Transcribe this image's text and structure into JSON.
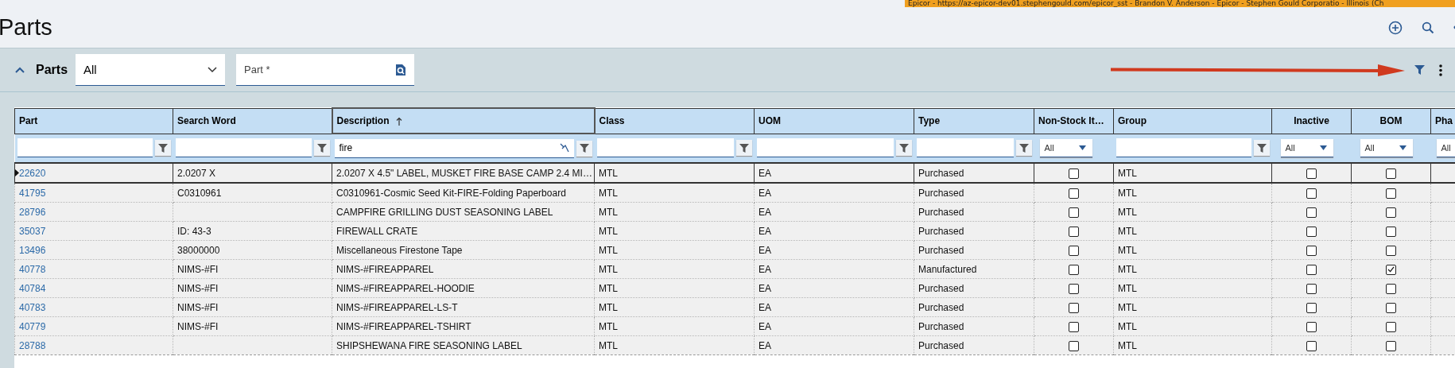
{
  "banner": {
    "text": "Epicor - https://az-epicor-dev01.stephengould.com/epicor_sst - Brandon V. Anderson - Epicor - Stephen Gould Corporatio - Illinois (Ch"
  },
  "page_title": "Parts",
  "toolbar": {
    "title": "Parts",
    "expanded": true,
    "view_select": {
      "value": "All"
    },
    "part_field": {
      "placeholder": "Part *"
    }
  },
  "table": {
    "columns": [
      {
        "label": "Part",
        "filter": {
          "kind": "text"
        },
        "sorted": false
      },
      {
        "label": "Search Word",
        "filter": {
          "kind": "text"
        },
        "sorted": false
      },
      {
        "label": "Description",
        "filter": {
          "kind": "text",
          "value": "fire"
        },
        "sorted": true
      },
      {
        "label": "Class",
        "filter": {
          "kind": "text"
        },
        "sorted": false
      },
      {
        "label": "UOM",
        "filter": {
          "kind": "text"
        },
        "sorted": false
      },
      {
        "label": "Type",
        "filter": {
          "kind": "text"
        },
        "sorted": false
      },
      {
        "label": "Non-Stock It…",
        "filter": {
          "kind": "select",
          "value": "All"
        },
        "sorted": false
      },
      {
        "label": "Group",
        "filter": {
          "kind": "text"
        },
        "sorted": false
      },
      {
        "label": "Inactive",
        "filter": {
          "kind": "select",
          "value": "All"
        },
        "sorted": false
      },
      {
        "label": "BOM",
        "filter": {
          "kind": "select",
          "value": "All"
        },
        "sorted": false
      },
      {
        "label": "Pha",
        "filter": {
          "kind": "select",
          "value": "All"
        },
        "sorted": false
      }
    ],
    "rows": [
      {
        "selected": true,
        "part": "22620",
        "search_word": "2.0207 X",
        "description": "2.0207 X 4.5\" LABEL, MUSKET FIRE BASE CAMP 2.4 MI…",
        "class": "MTL",
        "uom": "EA",
        "type": "Purchased",
        "non_stock": false,
        "group": "MTL",
        "inactive": false,
        "bom": false
      },
      {
        "selected": false,
        "part": "41795",
        "search_word": "C0310961",
        "description": "C0310961-Cosmic Seed Kit-FIRE-Folding Paperboard",
        "class": "MTL",
        "uom": "EA",
        "type": "Purchased",
        "non_stock": false,
        "group": "MTL",
        "inactive": false,
        "bom": false
      },
      {
        "selected": false,
        "part": "28796",
        "description": "CAMPFIRE GRILLING DUST SEASONING LABEL",
        "class": "MTL",
        "uom": "EA",
        "type": "Purchased",
        "non_stock": false,
        "group": "MTL",
        "inactive": false,
        "bom": false
      },
      {
        "selected": false,
        "part": "35037",
        "search_word": "ID: 43-3",
        "description": "FIREWALL CRATE",
        "class": "MTL",
        "uom": "EA",
        "type": "Purchased",
        "non_stock": false,
        "group": "MTL",
        "inactive": false,
        "bom": false
      },
      {
        "selected": false,
        "part": "13496",
        "search_word": "38000000",
        "description": "Miscellaneous Firestone Tape",
        "class": "MTL",
        "uom": "EA",
        "type": "Purchased",
        "non_stock": false,
        "group": "MTL",
        "inactive": false,
        "bom": false
      },
      {
        "selected": false,
        "part": "40778",
        "search_word": "NIMS-#FI",
        "description": "NIMS-#FIREAPPAREL",
        "class": "MTL",
        "uom": "EA",
        "type": "Manufactured",
        "non_stock": false,
        "group": "MTL",
        "inactive": false,
        "bom": true
      },
      {
        "selected": false,
        "part": "40784",
        "search_word": "NIMS-#FI",
        "description": "NIMS-#FIREAPPAREL-HOODIE",
        "class": "MTL",
        "uom": "EA",
        "type": "Purchased",
        "non_stock": false,
        "group": "MTL",
        "inactive": false,
        "bom": false
      },
      {
        "selected": false,
        "part": "40783",
        "search_word": "NIMS-#FI",
        "description": "NIMS-#FIREAPPAREL-LS-T",
        "class": "MTL",
        "uom": "EA",
        "type": "Purchased",
        "non_stock": false,
        "group": "MTL",
        "inactive": false,
        "bom": false
      },
      {
        "selected": false,
        "part": "40779",
        "search_word": "NIMS-#FI",
        "description": "NIMS-#FIREAPPAREL-TSHIRT",
        "class": "MTL",
        "uom": "EA",
        "type": "Purchased",
        "non_stock": false,
        "group": "MTL",
        "inactive": false,
        "bom": false
      },
      {
        "selected": false,
        "part": "28788",
        "description": "SHIPSHEWANA FIRE SEASONING LABEL",
        "class": "MTL",
        "uom": "EA",
        "type": "Purchased",
        "non_stock": false,
        "group": "MTL",
        "inactive": false,
        "bom": false
      }
    ]
  }
}
